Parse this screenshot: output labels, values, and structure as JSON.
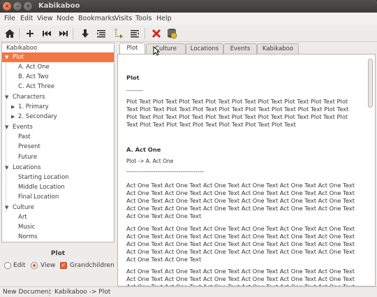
{
  "window": {
    "title": "Kabikaboo"
  },
  "menu": [
    "File",
    "Edit",
    "View",
    "Node",
    "Bookmarks",
    "Visits",
    "Tools",
    "Help"
  ],
  "toolbar": {
    "icons": [
      "home-icon",
      "add-icon",
      "previous-icon",
      "next-icon",
      "move-down-icon",
      "indent-icon",
      "collapse-icon",
      "outdent-icon",
      "delete-icon",
      "save-database-icon"
    ]
  },
  "tree": {
    "root": "Kabikaboo",
    "plot": "Plot",
    "plot_children": [
      "A. Act One",
      "B. Act Two",
      "C. Act Three"
    ],
    "characters": "Characters",
    "characters_children": [
      "1. Primary",
      "2. Secondary"
    ],
    "events": "Events",
    "events_children": [
      "Past",
      "Present",
      "Future"
    ],
    "locations": "Locations",
    "locations_children": [
      "Starting Location",
      "Middle Location",
      "Final Location"
    ],
    "culture": "Culture",
    "culture_children": [
      "Art",
      "Music",
      "Norms"
    ]
  },
  "panel": {
    "current_node": "Plot",
    "edit_label": "Edit",
    "view_label": "View",
    "grandchildren_label": "Grandchildren",
    "mode": "View",
    "grandchildren_checked": true
  },
  "tabs": [
    "Plot",
    "Culture",
    "Locations",
    "Events",
    "Kabikaboo"
  ],
  "active_tab": "Plot",
  "document": {
    "heading1": "Plot",
    "rule1": "--------",
    "para1": "Plot Text Plot Text Plot Text Plot Text Plot Text Plot Text Plot Text Plot Text Plot Text Plot Text Plot Text Plot Text Plot Text Plot Text Plot Text Plot Text Plot Text Plot Text Plot Text Plot Text Plot Text Plot Text Plot Text Plot Text Plot Text Plot Text Plot Text Plot Text Plot Text Plot Text Plot Text Plot Text",
    "heading2": "A. Act One",
    "path2": "Plot -> A. Act One",
    "rule2": "-------------------------------------",
    "para2": "Act One Text Act One Text Act One Text Act One Text Act One Text Act One Text Act One Text Act One Text Act One Text Act One Text Act One Text Act One Text Act One Text Act One Text Act One Text Act One Text Act One Text Act One Text Act One Text Act One Text Act One Text Act One Text Act One Text Act One Text Act One Text Act One Text",
    "para3": "Act One Text Act One Text Act One Text Act One Text Act One Text Act One Text Act One Text Act One Text Act One Text Act One Text Act One Text Act One Text Act One Text Act One Text Act One Text Act One Text Act One Text Act One Text Act One Text Act One Text Act One Text Act One Text Act One Text Act One Text Act One Text Act One Text",
    "para4": "Act One Text Act One Text Act One Text Act One Text Act One Text Act One Text Act One Text Act One Text Act One Text Act One Text Act One Text Act One Text Act One Text Act One Text Act One Text Act One Text Act One Text Act One Text Act One Text Act One Text"
  },
  "status": {
    "left": "New Document",
    "path": "Kabikaboo -> Plot"
  },
  "colors": {
    "accent": "#f07746",
    "titlebar": "#3c3b37"
  }
}
